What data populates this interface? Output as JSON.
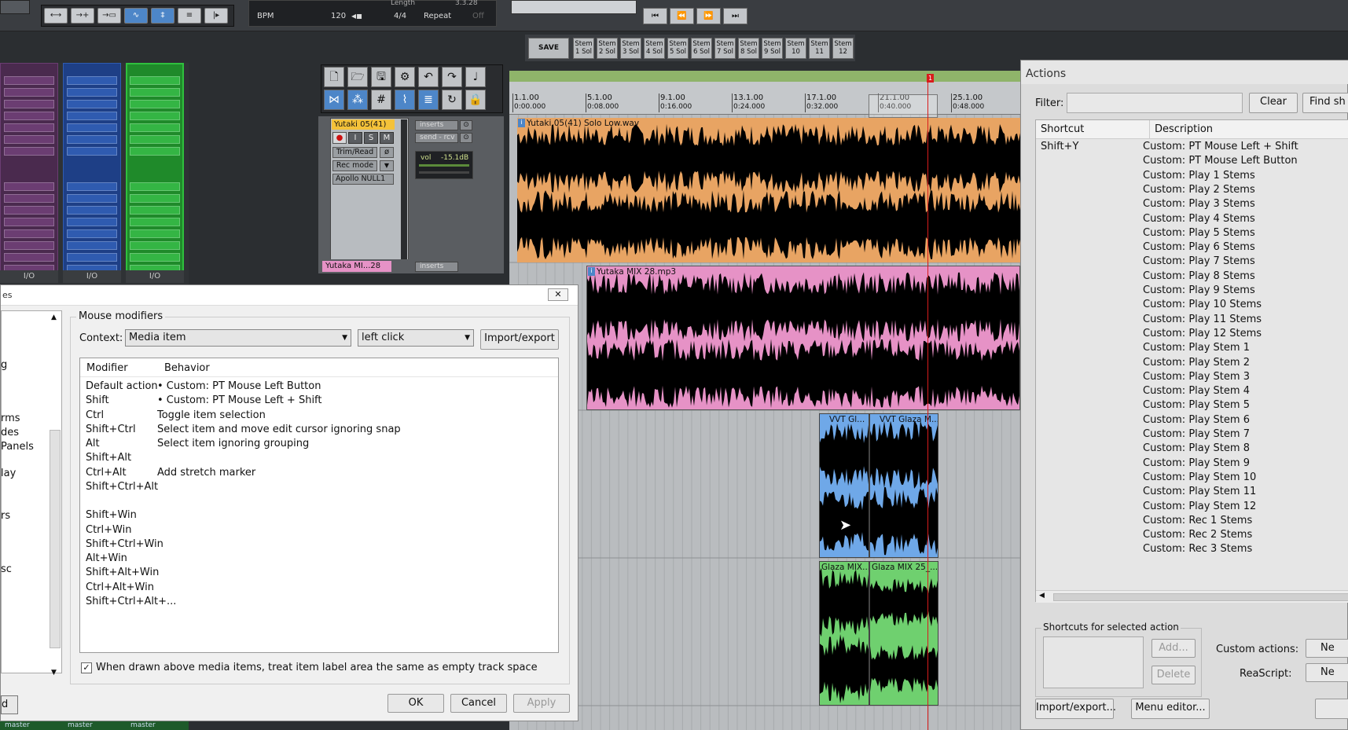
{
  "transport": {
    "bpm_label": "BPM",
    "bpm_value": "120",
    "time_sig": "4/4",
    "repeat_label": "Repeat",
    "repeat_state": "Off",
    "length_label": "Length",
    "length_value": "3.3.28"
  },
  "stems": {
    "save_label": "SAVE",
    "buttons": [
      "Stem 1 Sol",
      "Stem 2 Sol",
      "Stem 3 Sol",
      "Stem 4 Sol",
      "Stem 5 Sol",
      "Stem 6 Sol",
      "Stem 7 Sol",
      "Stem 8 Sol",
      "Stem 9 Sol",
      "Stem 10",
      "Stem 11",
      "Stem 12"
    ]
  },
  "mixer": {
    "io_labels": [
      "I/O",
      "I/O",
      "I/O"
    ],
    "master_labels": [
      "master",
      "master",
      "master"
    ]
  },
  "track1": {
    "name": "Yutaki 05(41)",
    "inserts": "inserts",
    "send": "send - rcv",
    "automation": "Trim/Read",
    "rec_mode": "Rec mode",
    "input": "Apollo NULL1",
    "vol_label": "vol",
    "vol_value": "-15.1dB",
    "rec": "●",
    "input_mon": "I",
    "solo": "S",
    "mute": "M"
  },
  "track2": {
    "name": "Yutaka MI...28",
    "inserts": "inserts"
  },
  "ruler": {
    "marks": [
      {
        "bar": "1.1.00",
        "time": "0:00.000"
      },
      {
        "bar": "5.1.00",
        "time": "0:08.000"
      },
      {
        "bar": "9.1.00",
        "time": "0:16.000"
      },
      {
        "bar": "13.1.00",
        "time": "0:24.000"
      },
      {
        "bar": "17.1.00",
        "time": "0:32.000"
      },
      {
        "bar": "21.1.00",
        "time": "0:40.000"
      },
      {
        "bar": "25.1.00",
        "time": "0:48.000"
      }
    ],
    "marker": "1"
  },
  "clips": {
    "c1": "Yutaki 05(41) Solo Low.wav",
    "c2": "Yutaka MIX 28.mp3",
    "c3a": "VVT Gl...",
    "c3b": "VVT Glaza M...",
    "c4a": "Glaza MIX...",
    "c4b": "Glaza MIX 25_..."
  },
  "prefs": {
    "title": "es",
    "sidebar_items": [
      "g",
      "rms",
      "des",
      "Panels",
      "lay",
      "rs",
      "sc"
    ],
    "group_label": "Mouse modifiers",
    "context_label": "Context:",
    "context_value": "Media item",
    "click_value": "left click",
    "import_export": "Import/export",
    "col_modifier": "Modifier",
    "col_behavior": "Behavior",
    "rows": [
      {
        "mod": "Default action",
        "beh": "• Custom: PT Mouse Left Button"
      },
      {
        "mod": "Shift",
        "beh": "• Custom: PT Mouse Left + Shift"
      },
      {
        "mod": "Ctrl",
        "beh": "Toggle item selection"
      },
      {
        "mod": "Shift+Ctrl",
        "beh": "Select item and move edit cursor ignoring snap"
      },
      {
        "mod": "Alt",
        "beh": "Select item ignoring grouping"
      },
      {
        "mod": "Shift+Alt",
        "beh": ""
      },
      {
        "mod": "Ctrl+Alt",
        "beh": "Add stretch marker"
      },
      {
        "mod": "Shift+Ctrl+Alt",
        "beh": ""
      },
      {
        "mod": "",
        "beh": ""
      },
      {
        "mod": "Shift+Win",
        "beh": ""
      },
      {
        "mod": "Ctrl+Win",
        "beh": ""
      },
      {
        "mod": "Shift+Ctrl+Win",
        "beh": ""
      },
      {
        "mod": "Alt+Win",
        "beh": ""
      },
      {
        "mod": "Shift+Alt+Win",
        "beh": ""
      },
      {
        "mod": "Ctrl+Alt+Win",
        "beh": ""
      },
      {
        "mod": "Shift+Ctrl+Alt+...",
        "beh": ""
      }
    ],
    "checkbox_label": "When drawn above media items, treat item label area the same as empty track space",
    "ok": "OK",
    "cancel": "Cancel",
    "apply": "Apply",
    "left_btn": "d"
  },
  "actions": {
    "title": "Actions",
    "filter_label": "Filter:",
    "clear": "Clear",
    "find": "Find sh",
    "col_shortcut": "Shortcut",
    "col_description": "Description",
    "rows": [
      {
        "sc": "Shift+Y",
        "desc": "Custom: PT Mouse Left + Shift"
      },
      {
        "sc": "",
        "desc": "Custom: PT Mouse Left Button"
      },
      {
        "sc": "",
        "desc": "Custom: Play 1 Stems"
      },
      {
        "sc": "",
        "desc": "Custom: Play 2 Stems"
      },
      {
        "sc": "",
        "desc": "Custom: Play 3 Stems"
      },
      {
        "sc": "",
        "desc": "Custom: Play 4 Stems"
      },
      {
        "sc": "",
        "desc": "Custom: Play 5 Stems"
      },
      {
        "sc": "",
        "desc": "Custom: Play 6 Stems"
      },
      {
        "sc": "",
        "desc": "Custom: Play 7 Stems"
      },
      {
        "sc": "",
        "desc": "Custom: Play 8 Stems"
      },
      {
        "sc": "",
        "desc": "Custom: Play 9 Stems"
      },
      {
        "sc": "",
        "desc": "Custom: Play 10 Stems"
      },
      {
        "sc": "",
        "desc": "Custom: Play 11 Stems"
      },
      {
        "sc": "",
        "desc": "Custom: Play 12 Stems"
      },
      {
        "sc": "",
        "desc": "Custom: Play Stem 1"
      },
      {
        "sc": "",
        "desc": "Custom: Play Stem 2"
      },
      {
        "sc": "",
        "desc": "Custom: Play Stem 3"
      },
      {
        "sc": "",
        "desc": "Custom: Play Stem 4"
      },
      {
        "sc": "",
        "desc": "Custom: Play Stem 5"
      },
      {
        "sc": "",
        "desc": "Custom: Play Stem 6"
      },
      {
        "sc": "",
        "desc": "Custom: Play Stem 7"
      },
      {
        "sc": "",
        "desc": "Custom: Play Stem 8"
      },
      {
        "sc": "",
        "desc": "Custom: Play Stem 9"
      },
      {
        "sc": "",
        "desc": "Custom: Play Stem 10"
      },
      {
        "sc": "",
        "desc": "Custom: Play Stem 11"
      },
      {
        "sc": "",
        "desc": "Custom: Play Stem 12"
      },
      {
        "sc": "",
        "desc": "Custom: Rec 1 Stems"
      },
      {
        "sc": "",
        "desc": "Custom: Rec 2 Stems"
      },
      {
        "sc": "",
        "desc": "Custom: Rec 3 Stems"
      }
    ],
    "shortcuts_group": "Shortcuts for selected action",
    "add": "Add...",
    "delete": "Delete",
    "custom_actions": "Custom actions:",
    "reascript": "ReaScript:",
    "new1": "Ne",
    "new2": "Ne",
    "import_export": "Import/export...",
    "menu_editor": "Menu editor..."
  },
  "colors": {
    "orange": "#e8a463",
    "pink": "#e692c6",
    "blue": "#6fa8e8",
    "green": "#6fd06f",
    "cursor": "#d81c1c"
  }
}
